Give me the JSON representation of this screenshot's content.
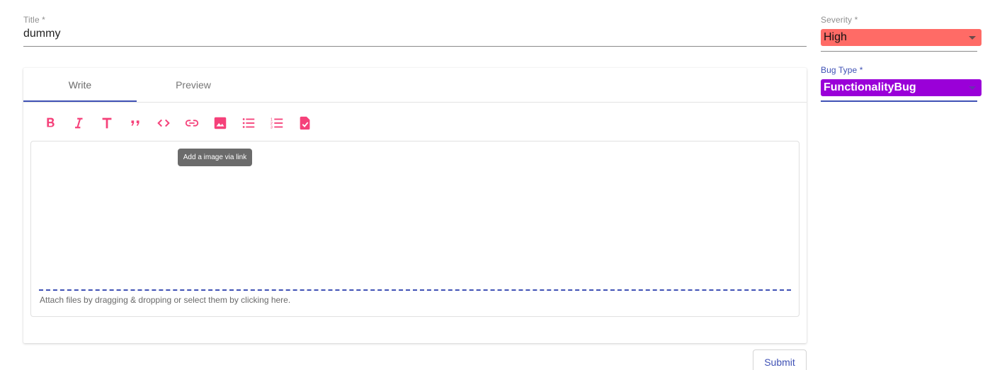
{
  "title_field": {
    "label": "Title *",
    "value": "dummy"
  },
  "tabs": [
    {
      "label": "Write"
    },
    {
      "label": "Preview"
    }
  ],
  "toolbar": {
    "icons": [
      "bold-icon",
      "italic-icon",
      "heading-icon",
      "quote-icon",
      "code-icon",
      "link-icon",
      "image-icon",
      "bulleted-list-icon",
      "numbered-list-icon",
      "task-list-icon"
    ],
    "icon_color": "#f5417a"
  },
  "tooltip": "Add a image via link",
  "attach_text": "Attach files by dragging & dropping or select them by clicking here.",
  "submit_label": "Submit",
  "severity": {
    "label": "Severity *",
    "value": "High",
    "color": "#ff6b66"
  },
  "bug_type": {
    "label": "Bug Type *",
    "value": "FunctionalityBug",
    "color": "#9a00d8"
  },
  "accent_color": "#3f51b5"
}
